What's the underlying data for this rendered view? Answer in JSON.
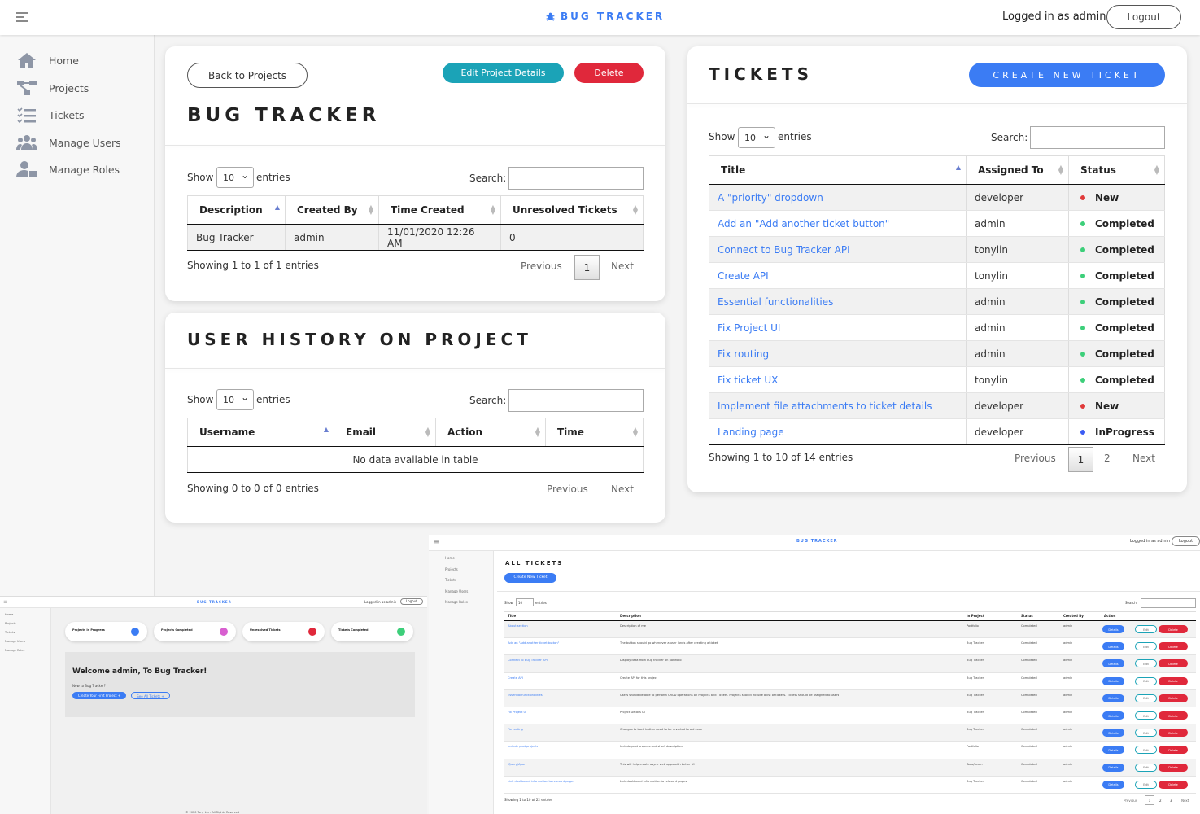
{
  "topbar": {
    "brand": "BUG TRACKER",
    "logged_in": "Logged in as admin",
    "logout": "Logout"
  },
  "sidebar": {
    "items": [
      {
        "label": "Home",
        "icon": "home-icon"
      },
      {
        "label": "Projects",
        "icon": "projects-icon"
      },
      {
        "label": "Tickets",
        "icon": "tickets-icon"
      },
      {
        "label": "Manage Users",
        "icon": "users-icon"
      },
      {
        "label": "Manage Roles",
        "icon": "roles-icon"
      }
    ]
  },
  "project": {
    "back": "Back to Projects",
    "edit": "Edit Project Details",
    "delete": "Delete",
    "title": "BUG TRACKER",
    "show": "Show",
    "entries_value": "10",
    "entries": "entries",
    "search": "Search:",
    "columns": [
      "Description",
      "Created By",
      "Time Created",
      "Unresolved Tickets"
    ],
    "row": [
      "Bug Tracker",
      "admin",
      "11/01/2020 12:26 AM",
      "0"
    ],
    "info": "Showing 1 to 1 of 1 entries",
    "previous": "Previous",
    "page": "1",
    "next": "Next"
  },
  "history": {
    "title": "USER HISTORY ON PROJECT",
    "show": "Show",
    "entries_value": "10",
    "entries": "entries",
    "search": "Search:",
    "columns": [
      "Username",
      "Email",
      "Action",
      "Time"
    ],
    "empty": "No data available in table",
    "info": "Showing 0 to 0 of 0 entries",
    "previous": "Previous",
    "next": "Next"
  },
  "tickets": {
    "title": "TICKETS",
    "create": "CREATE NEW TICKET",
    "show": "Show",
    "entries_value": "10",
    "entries": "entries",
    "search": "Search:",
    "columns": [
      "Title",
      "Assigned To",
      "Status"
    ],
    "rows": [
      [
        "A \"priority\" dropdown",
        "developer",
        "New"
      ],
      [
        "Add an \"Add another ticket button\"",
        "admin",
        "Completed"
      ],
      [
        "Connect to Bug Tracker API",
        "tonylin",
        "Completed"
      ],
      [
        "Create API",
        "tonylin",
        "Completed"
      ],
      [
        "Essential functionalities",
        "admin",
        "Completed"
      ],
      [
        "Fix Project UI",
        "admin",
        "Completed"
      ],
      [
        "Fix routing",
        "admin",
        "Completed"
      ],
      [
        "Fix ticket UX",
        "tonylin",
        "Completed"
      ],
      [
        "Implement file attachments to ticket details",
        "developer",
        "New"
      ],
      [
        "Landing page",
        "developer",
        "InProgress"
      ]
    ],
    "status_colors": {
      "New": "#e03a3a",
      "Completed": "#3dcf7a",
      "InProgress": "#3b5cf4"
    },
    "info": "Showing 1 to 10 of 14 entries",
    "previous": "Previous",
    "pages": [
      "1",
      "2"
    ],
    "next": "Next"
  },
  "dashboard_shot": {
    "brand": "BUG TRACKER",
    "logged": "Logged in as admin",
    "logout": "Logout",
    "nav": [
      "Home",
      "Projects",
      "Tickets",
      "Manage Users",
      "Manage Roles"
    ],
    "stats": [
      "Projects In Progress",
      "Projects Completed",
      "Unresolved Tickets",
      "Tickets Completed"
    ],
    "welcome": "Welcome admin, To Bug Tracker!",
    "new_to": "New to Bug Tracker?",
    "create_first": "Create Your First Project +",
    "see_all": "See All Tickets +",
    "footer": "© 2020 Tony Lin - All Rights Reserved"
  },
  "all_tickets_shot": {
    "brand": "BUG TRACKER",
    "logged": "Logged in as admin",
    "logout": "Logout",
    "nav": [
      "Home",
      "Projects",
      "Tickets",
      "Manage Users",
      "Manage Roles"
    ],
    "title": "ALL TICKETS",
    "create": "Create New Ticket",
    "show": "Show",
    "entries_value": "10",
    "entries": "entries",
    "search": "Search:",
    "columns": [
      "Title",
      "Description",
      "In Project",
      "Status",
      "Created By",
      "Action"
    ],
    "rows": [
      [
        "About section",
        "Description of me",
        "Portfolio",
        "Completed",
        "admin"
      ],
      [
        "Add an \"Add another ticket button\"",
        "The button should go whenever a user lands after creating a ticket",
        "Bug Tracker",
        "Completed",
        "admin"
      ],
      [
        "Connect to Bug Tracker API",
        "Display data from bug tracker on portfolio",
        "Bug Tracker",
        "Completed",
        "admin"
      ],
      [
        "Create API",
        "Create API for this project",
        "Bug Tracker",
        "Completed",
        "admin"
      ],
      [
        "Essential functionalities",
        "Users should be able to perform CRUD operations on Projects and Tickets. Projects should include a list of tickets. Tickets should be assigned to users",
        "Bug Tracker",
        "Completed",
        "admin"
      ],
      [
        "Fix Project UI",
        "Project Details UI",
        "Bug Tracker",
        "Completed",
        "admin"
      ],
      [
        "Fix routing",
        "Changes to back button need to be reverted to old code",
        "Bug Tracker",
        "Completed",
        "admin"
      ],
      [
        "Include past projects",
        "Include past projects and short description",
        "Portfolio",
        "Completed",
        "admin"
      ],
      [
        "jQuery/Ajax",
        "This will help create async web apps with better UI",
        "Todo/Learn",
        "Completed",
        "admin"
      ],
      [
        "Link dashboard information to relevant pages",
        "Link dashboard information to relevant pages",
        "Bug Tracker",
        "Completed",
        "admin"
      ]
    ],
    "actions": [
      "Details",
      "Edit",
      "Delete"
    ],
    "info": "Showing 1 to 10 of 22 entries",
    "previous": "Previous",
    "pages": [
      "1",
      "2",
      "3"
    ],
    "next": "Next"
  }
}
